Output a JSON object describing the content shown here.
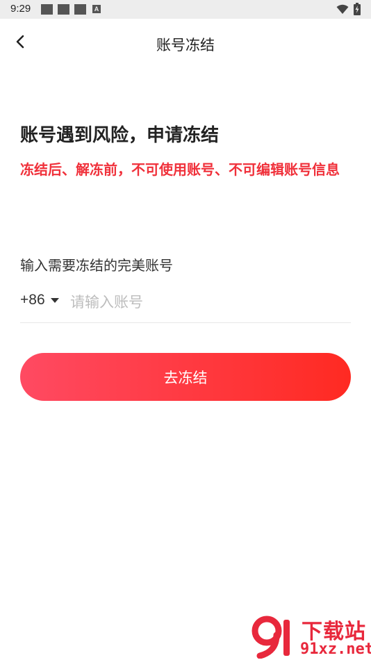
{
  "status_bar": {
    "time": "9:29",
    "notification_letter": "A",
    "icons": [
      "notification-square-icon",
      "notification-square-icon",
      "notification-square-icon",
      "a-notification-icon",
      "wifi-icon",
      "battery-icon"
    ]
  },
  "header": {
    "title": "账号冻结",
    "back_icon": "chevron-left-icon"
  },
  "content": {
    "headline": "账号遇到风险，申请冻结",
    "warning": "冻结后、解冻前，不可使用账号、不可编辑账号信息",
    "input_label": "输入需要冻结的完美账号",
    "country_code": "+86",
    "phone_placeholder": "请输入账号",
    "phone_value": "",
    "submit_label": "去冻结"
  },
  "watermark": {
    "text": "下载站",
    "url": "91xz.net"
  },
  "colors": {
    "accent_red": "#f0303a",
    "button_gradient_start": "#ff4a62",
    "button_gradient_end": "#ff2a22",
    "watermark_red": "#e8283c"
  }
}
